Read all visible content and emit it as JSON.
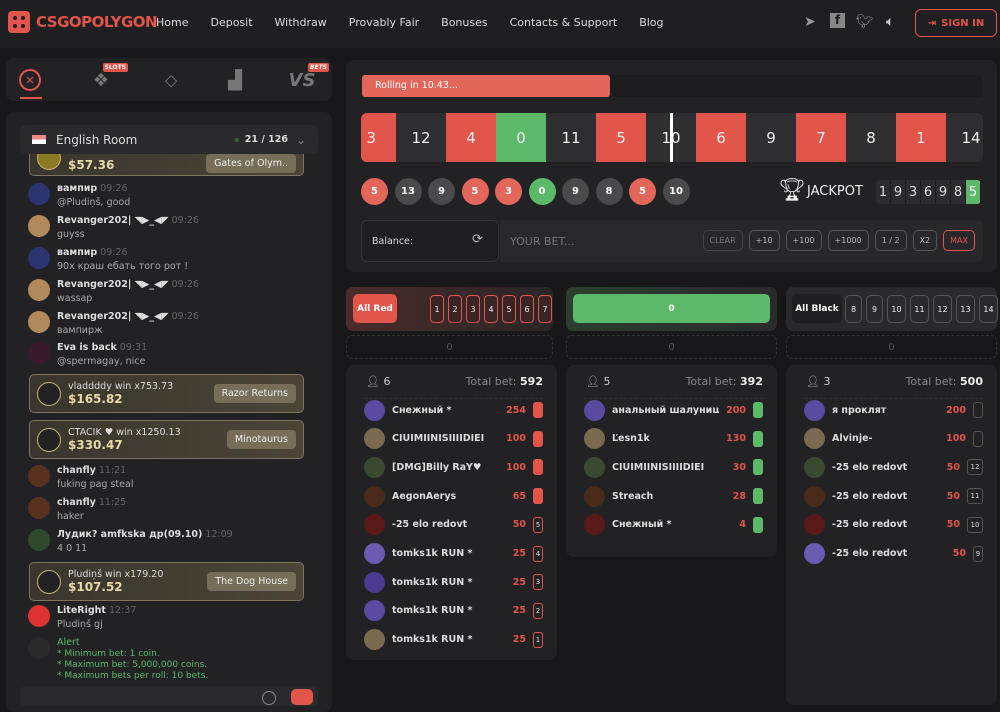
{
  "header": {
    "brand": "CSGOPOLYGON",
    "nav": [
      "Home",
      "Deposit",
      "Withdraw",
      "Provably Fair",
      "Bonuses",
      "Contacts & Support",
      "Blog"
    ],
    "sign_in": "SIGN IN",
    "icons": [
      "telegram-icon",
      "facebook-icon",
      "twitter-icon",
      "sound-icon"
    ]
  },
  "game_tabs": [
    {
      "name": "roulette",
      "active": true
    },
    {
      "name": "slots",
      "badge": "SLOTS"
    },
    {
      "name": "dice"
    },
    {
      "name": "crash"
    },
    {
      "name": "versus",
      "badge": "BETS"
    }
  ],
  "chat": {
    "room": "English Room",
    "online": "21 / 126",
    "partial_win": {
      "amount": "$57.36",
      "game": "Gates of Olym.."
    },
    "messages": [
      {
        "type": "msg",
        "user": "вампир",
        "time": "09:26",
        "text": "@Pludiņš, good",
        "color": "#2d3570"
      },
      {
        "type": "msg",
        "user": "Revanger202| ◥▶_◀◤",
        "time": "09:26",
        "text": "guyss",
        "color": "#b08a5c"
      },
      {
        "type": "msg",
        "user": "вампир",
        "time": "09:26",
        "text": "90x краш ебать того рот !",
        "color": "#2d3570"
      },
      {
        "type": "msg",
        "user": "Revanger202| ◥▶_◀◤",
        "time": "09:26",
        "text": "wassap",
        "color": "#b08a5c"
      },
      {
        "type": "msg",
        "user": "Revanger202| ◥▶_◀◤",
        "time": "09:26",
        "text": "вампирж",
        "color": "#b08a5c"
      },
      {
        "type": "msg",
        "user": "Eva is back",
        "time": "09:31",
        "text": "@spermagay, nice",
        "color": "#3a1a2a"
      },
      {
        "type": "win",
        "text": "vladdddy win x753.73",
        "amount": "$165.82",
        "game": "Razor Returns"
      },
      {
        "type": "win",
        "text": "CTACIK ♥ win x1250.13",
        "amount": "$330.47",
        "game": "Minotaurus"
      },
      {
        "type": "msg",
        "user": "chanfly",
        "time": "11:21",
        "text": "fuking pag steal",
        "color": "#5a3020"
      },
      {
        "type": "msg",
        "user": "chanfly",
        "time": "11:25",
        "text": "haker",
        "color": "#5a3020"
      },
      {
        "type": "msg",
        "user": "Лудик? amfkska дp(09.10)",
        "time": "12:09",
        "text": "4 0 11",
        "color": "#2e4a2a"
      },
      {
        "type": "win",
        "text": "Pludiņš win x179.20",
        "amount": "$107.52",
        "game": "The Dog House"
      },
      {
        "type": "msg",
        "user": "LiteRight",
        "time": "12:37",
        "text": "Pludiņš gj",
        "color": "#d33"
      },
      {
        "type": "alert",
        "user": "Alert",
        "lines": [
          "* Minimum bet: 1 coin.",
          "* Maximum bet: 5,000,000 coins.",
          "* Maximum bets per roll: 10 bets."
        ],
        "color": "#2a2a2a"
      }
    ]
  },
  "roulette": {
    "status": "Rolling in 10.43...",
    "progress": 0.4,
    "strip": [
      "3",
      "12",
      "4",
      "0",
      "11",
      "5",
      "10",
      "6",
      "9",
      "7",
      "8",
      "1",
      "14"
    ],
    "history": [
      "5",
      "13",
      "9",
      "5",
      "3",
      "0",
      "9",
      "8",
      "5",
      "10"
    ],
    "jackpot_label": "JACKPOT",
    "jackpot_digits": [
      "1",
      "9",
      "3",
      "6",
      "9",
      "8",
      "5"
    ],
    "balance_label": "Balance:",
    "bet_placeholder": "YOUR BET...",
    "buttons": [
      "CLEAR",
      "+10",
      "+100",
      "+1000",
      "1 / 2",
      "X2",
      "MAX"
    ]
  },
  "colors": {
    "red": "#e2554a",
    "green": "#5cb96a",
    "black": "#2f2f33"
  },
  "bets": {
    "total_label": "Total bet:",
    "red": {
      "label": "All Red",
      "numbers": [
        "1",
        "2",
        "3",
        "4",
        "5",
        "6",
        "7"
      ],
      "my_bet": "0",
      "players": "6",
      "total": "592",
      "rows": [
        {
          "name": "Снежный *",
          "amount": "254",
          "chip": ""
        },
        {
          "name": "CIUIMIINISIIIIDIEI",
          "amount": "100",
          "chip": ""
        },
        {
          "name": "[DMG]Billy RaY♥",
          "amount": "100",
          "chip": ""
        },
        {
          "name": "AegonAerys",
          "amount": "65",
          "chip": ""
        },
        {
          "name": "-25 elo redovt",
          "amount": "50",
          "chip": "5"
        },
        {
          "name": "tomks1k RUN *",
          "amount": "25",
          "chip": "4"
        },
        {
          "name": "tomks1k RUN *",
          "amount": "25",
          "chip": "3"
        },
        {
          "name": "tomks1k RUN *",
          "amount": "25",
          "chip": "2"
        },
        {
          "name": "tomks1k RUN *",
          "amount": "25",
          "chip": "1"
        }
      ]
    },
    "green": {
      "label": "0",
      "my_bet": "0",
      "players": "5",
      "total": "392",
      "rows": [
        {
          "name": "анальный шалуниш",
          "amount": "200",
          "chip": ""
        },
        {
          "name": "Ľesn1k",
          "amount": "130",
          "chip": ""
        },
        {
          "name": "CIUIMIINISIIIIDIEI",
          "amount": "30",
          "chip": ""
        },
        {
          "name": "Streach",
          "amount": "28",
          "chip": ""
        },
        {
          "name": "Снежный *",
          "amount": "4",
          "chip": ""
        }
      ]
    },
    "black": {
      "label": "All Black",
      "numbers": [
        "8",
        "9",
        "10",
        "11",
        "12",
        "13",
        "14"
      ],
      "my_bet": "0",
      "players": "3",
      "total": "500",
      "rows": [
        {
          "name": "я проклят",
          "amount": "200",
          "chip": ""
        },
        {
          "name": "Alvinje-",
          "amount": "100",
          "chip": ""
        },
        {
          "name": "-25 elo redovt",
          "amount": "50",
          "chip": "12"
        },
        {
          "name": "-25 elo redovt",
          "amount": "50",
          "chip": "11"
        },
        {
          "name": "-25 elo redovt",
          "amount": "50",
          "chip": "10"
        },
        {
          "name": "-25 elo redovt",
          "amount": "50",
          "chip": "9"
        }
      ]
    }
  }
}
